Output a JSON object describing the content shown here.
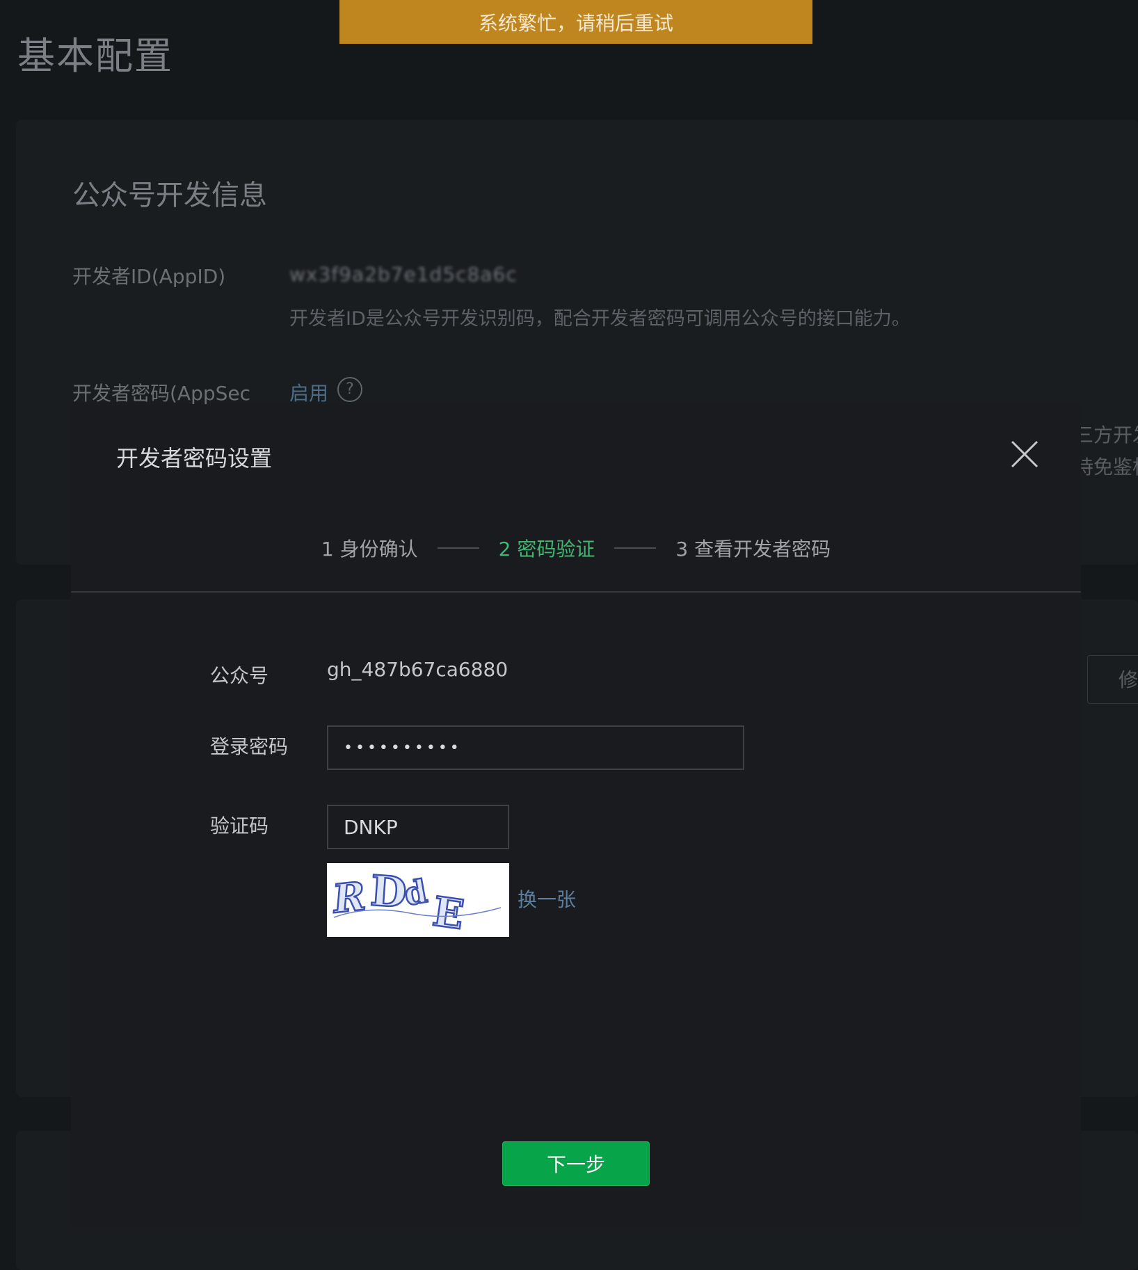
{
  "toast": {
    "message": "系统繁忙，请稍后重试"
  },
  "page": {
    "title": "基本配置"
  },
  "dev_info": {
    "section_title": "公众号开发信息",
    "appid_label": "开发者ID(AppID)",
    "appid_value": "wx3f9a2b7e1d5c8a6c",
    "appid_desc": "开发者ID是公众号开发识别码，配合开发者密码可调用公众号的接口能力。",
    "secret_label": "开发者密码(AppSec",
    "secret_enable_link": "启用",
    "help_icon": "question-circle-icon"
  },
  "background": {
    "side_text_1": "三方开发",
    "side_text_2": "持免鉴标",
    "side_button": "修"
  },
  "modal": {
    "title": "开发者密码设置",
    "close_icon": "close-icon",
    "steps": [
      {
        "label": "1 身份确认"
      },
      {
        "label": "2 密码验证"
      },
      {
        "label": "3 查看开发者密码"
      }
    ],
    "active_step": 2,
    "form": {
      "account_label": "公众号",
      "account_value": "gh_487b67ca6880",
      "password_label": "登录密码",
      "password_value": "••••••••••",
      "captcha_label": "验证码",
      "captcha_value": "DNKP",
      "captcha_image_text": "RDdE",
      "refresh_link": "换一张"
    },
    "next_button": "下一步"
  },
  "colors": {
    "toast_bg": "#bf8620",
    "active_step": "#3fb871",
    "primary_button": "#07a44a",
    "link": "#5c7fa0"
  }
}
